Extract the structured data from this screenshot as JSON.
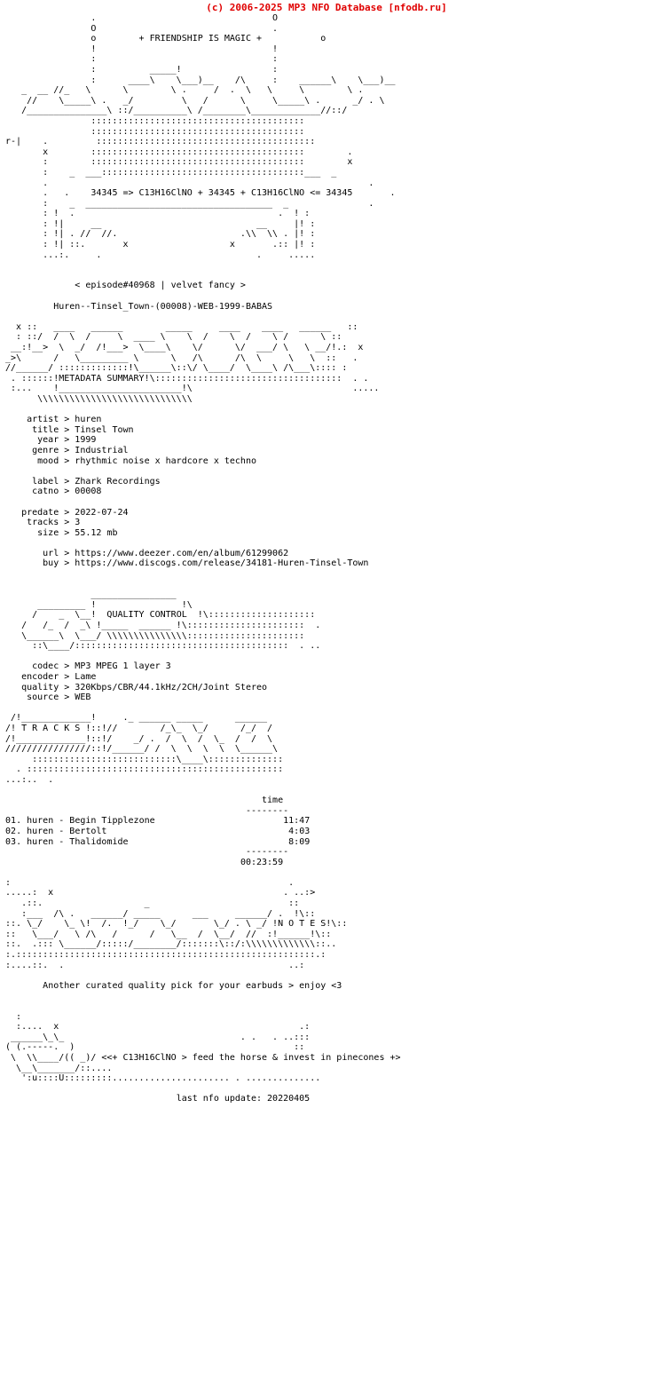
{
  "site_header": "(c) 2006-2025 MP3 NFO Database [nfodb.ru]",
  "tagline": "+ FRIENDSHIP IS MAGIC +",
  "chem_line": "34345 => C13H16ClNO + 34345 + C13H16ClNO <= 34345",
  "episode_line": "< episode#40968 | velvet fancy >",
  "release_name": "Huren--Tinsel_Town-(00008)-WEB-1999-BABAS",
  "banners": {
    "metadata": "METADATA SUMMARY",
    "quality": "QUALITY CONTROL",
    "tracks": "T R A C K S",
    "notes": "N O T E S"
  },
  "metadata": {
    "fields": [
      {
        "key": "artist",
        "value": "huren"
      },
      {
        "key": "title",
        "value": "Tinsel Town"
      },
      {
        "key": "year",
        "value": "1999"
      },
      {
        "key": "genre",
        "value": "Industrial"
      },
      {
        "key": "mood",
        "value": "rhythmic noise x hardcore x techno"
      }
    ],
    "label_fields": [
      {
        "key": "label",
        "value": "Zhark Recordings"
      },
      {
        "key": "catno",
        "value": "00008"
      }
    ],
    "release_fields": [
      {
        "key": "predate",
        "value": "2022-07-24"
      },
      {
        "key": "tracks",
        "value": "3"
      },
      {
        "key": "size",
        "value": "55.12 mb"
      }
    ],
    "link_fields": [
      {
        "key": "url",
        "value": "https://www.deezer.com/en/album/61299062"
      },
      {
        "key": "buy",
        "value": "https://www.discogs.com/release/34181-Huren-Tinsel-Town"
      }
    ]
  },
  "quality": {
    "fields": [
      {
        "key": "codec",
        "value": "MP3 MPEG 1 layer 3"
      },
      {
        "key": "encoder",
        "value": "Lame"
      },
      {
        "key": "quality",
        "value": "320Kbps/CBR/44.1kHz/2CH/Joint Stereo"
      },
      {
        "key": "source",
        "value": "WEB"
      }
    ]
  },
  "tracklist": {
    "time_header": "time",
    "rule": "--------",
    "items": [
      {
        "num": "01.",
        "artist": "huren",
        "title": "Begin Tipplezone",
        "time": "11:47"
      },
      {
        "num": "02.",
        "artist": "huren",
        "title": "Bertolt",
        "time": "4:03"
      },
      {
        "num": "03.",
        "artist": "huren",
        "title": "Thalidomide",
        "time": "8:09"
      }
    ],
    "total": "00:23:59"
  },
  "notes_text": "Another curated quality pick for your earbuds > enjoy <3",
  "footer_slogan": "<<+ C13H16ClNO > feed the horse & invest in pinecones +>",
  "last_update": "last nfo update: 20220405",
  "colors": {
    "header_red": "#e00000",
    "text_black": "#000000",
    "background": "#ffffff"
  },
  "ascii": {
    "top_art": "                      .                                          O\n                      O                                          .\n                      o            + FRIENDSHIP IS MAGIC +       o\n                      !                                          !\n                      :                                          :\n                      :           ___ !___                       :\n              ____ ___\\  ___/  __)___    /\\    ____ ___\\  ___/___:\n   _  __ //_ \\       \\ :      /  . \\    /  \\  \\       \\ :    /_ //\n    //   \\_____\\ :   _/ . \\  /_____\\   /____\\  \\_____\\ :   ._//\n   /______________\\ :://_________________\\\\ . : : : : : ://",
    "divider_dots": ":::::::::::::::::::::::::::::::::::::::::::::::"
  }
}
